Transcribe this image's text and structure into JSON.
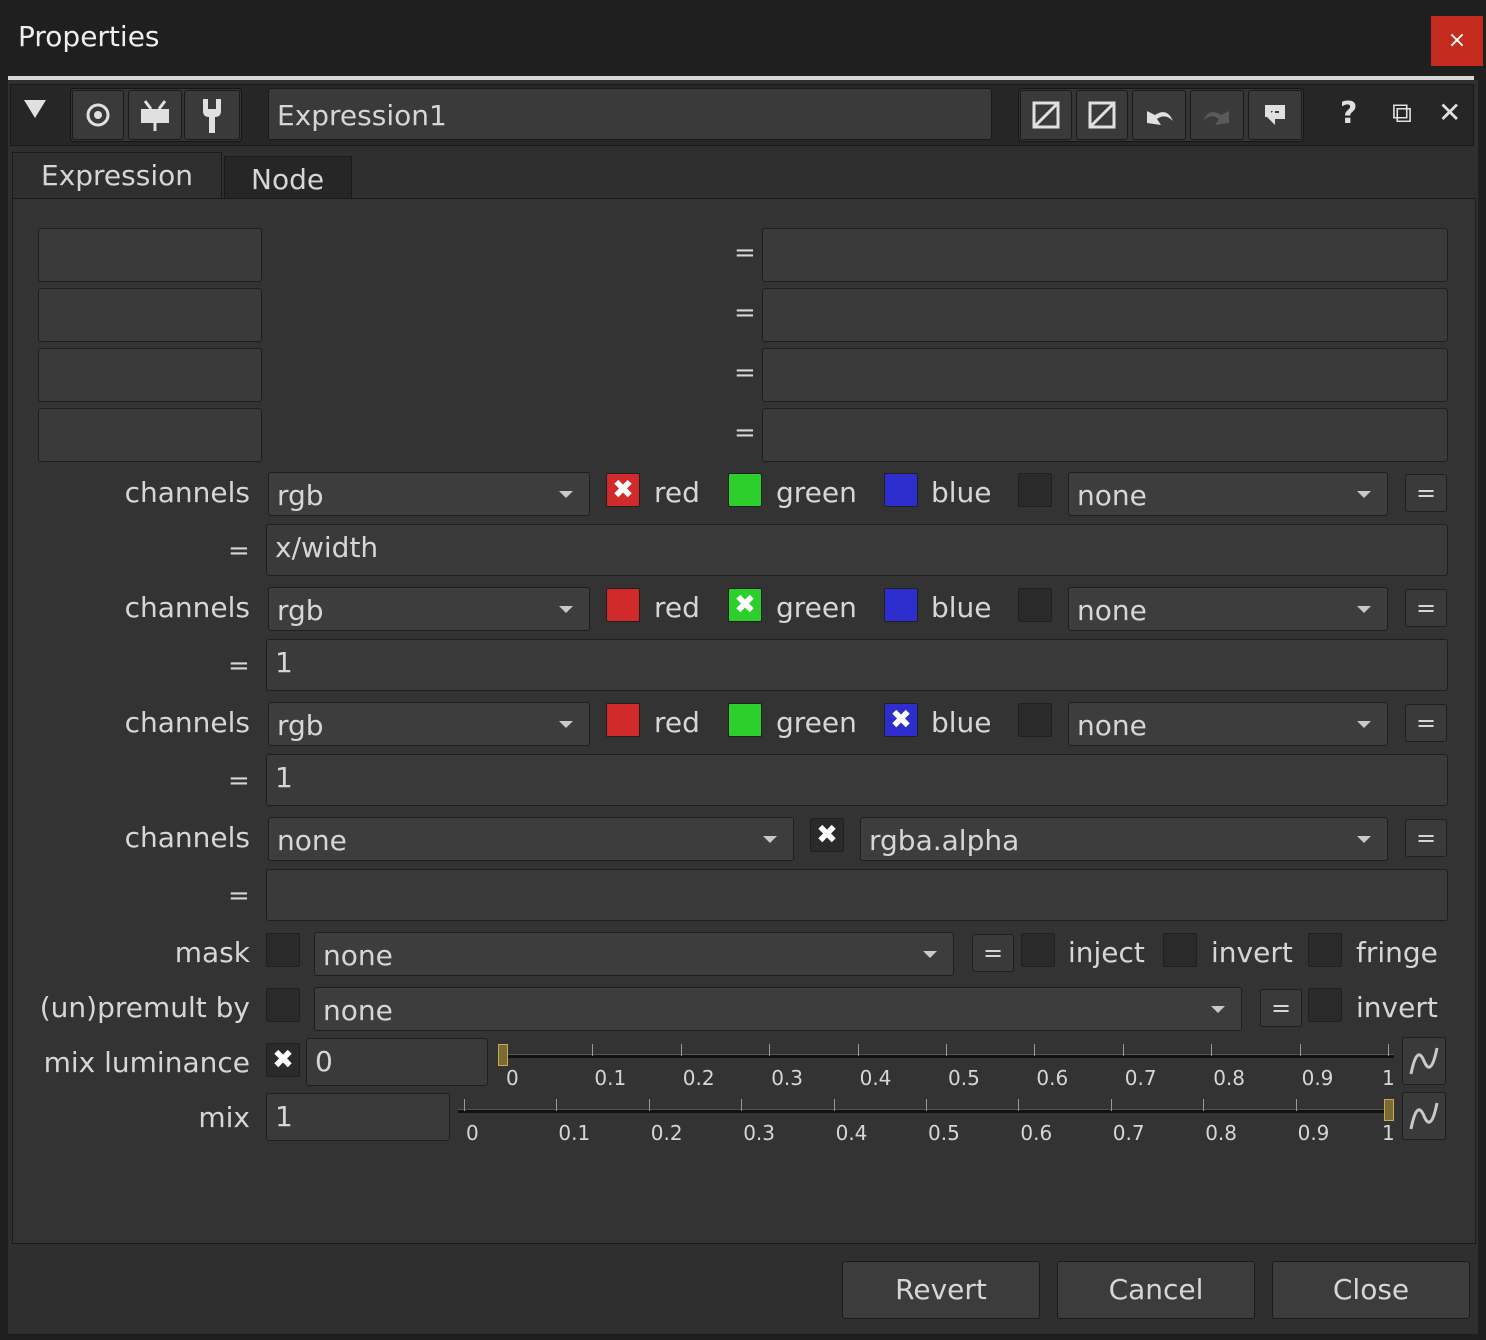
{
  "window": {
    "title": "Properties",
    "close_glyph": "×"
  },
  "toolbar": {
    "node_name": "Expression1",
    "help_glyph": "?",
    "float_glyph": "⧉",
    "close_glyph": "✕"
  },
  "tabs": [
    {
      "label": "Expression",
      "active": true
    },
    {
      "label": "Node",
      "active": false
    }
  ],
  "temp_rows": [
    {
      "name": "",
      "equals": "=",
      "expr": ""
    },
    {
      "name": "",
      "equals": "=",
      "expr": ""
    },
    {
      "name": "",
      "equals": "=",
      "expr": ""
    },
    {
      "name": "",
      "equals": "=",
      "expr": ""
    }
  ],
  "expr_blocks": [
    {
      "label": "channels",
      "layer": "rgb",
      "red": {
        "label": "red",
        "checked": true
      },
      "green": {
        "label": "green",
        "checked": false
      },
      "blue": {
        "label": "blue",
        "checked": false
      },
      "extra": "none",
      "eq_btn": "=",
      "equals": "=",
      "expr": "x/width"
    },
    {
      "label": "channels",
      "layer": "rgb",
      "red": {
        "label": "red",
        "checked": false
      },
      "green": {
        "label": "green",
        "checked": true
      },
      "blue": {
        "label": "blue",
        "checked": false
      },
      "extra": "none",
      "eq_btn": "=",
      "equals": "=",
      "expr": "1"
    },
    {
      "label": "channels",
      "layer": "rgb",
      "red": {
        "label": "red",
        "checked": false
      },
      "green": {
        "label": "green",
        "checked": false
      },
      "blue": {
        "label": "blue",
        "checked": true
      },
      "extra": "none",
      "eq_btn": "=",
      "equals": "=",
      "expr": "1"
    },
    {
      "label": "channels",
      "layer": "none",
      "alpha_checked": true,
      "extra": "rgba.alpha",
      "eq_btn": "=",
      "equals": "=",
      "expr": ""
    }
  ],
  "mask": {
    "label": "mask",
    "value": "none",
    "eq_btn": "=",
    "inject": "inject",
    "invert": "invert",
    "fringe": "fringe"
  },
  "unpremult": {
    "label": "(un)premult by",
    "value": "none",
    "eq_btn": "=",
    "invert": "invert"
  },
  "mix_luminance": {
    "label": "mix luminance",
    "checked": true,
    "value": "0",
    "level": 0,
    "ticks": [
      "0",
      "0.1",
      "0.2",
      "0.3",
      "0.4",
      "0.5",
      "0.6",
      "0.7",
      "0.8",
      "0.9",
      "1"
    ]
  },
  "mix": {
    "label": "mix",
    "value": "1",
    "level": 1,
    "ticks": [
      "0",
      "0.1",
      "0.2",
      "0.3",
      "0.4",
      "0.5",
      "0.6",
      "0.7",
      "0.8",
      "0.9",
      "1"
    ]
  },
  "buttons": {
    "revert": "Revert",
    "cancel": "Cancel",
    "close": "Close"
  },
  "colors": {
    "red": "#d12a2a",
    "green": "#2ccf2c",
    "blue": "#2e2ecf"
  }
}
